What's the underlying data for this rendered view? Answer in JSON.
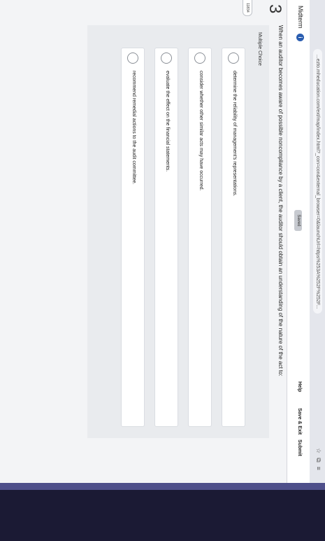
{
  "browser": {
    "url": "...ezto.mheducation.com/ext/map/index.html?_con=con&external_browser=0&launchUrl=https%253A%252F%252F..."
  },
  "header": {
    "title": "Midterm",
    "info_icon": "i",
    "saved_label": "Saved",
    "help_label": "Help",
    "save_exit_label": "Save & Exit",
    "submit_label": "Submit"
  },
  "question": {
    "number": "3",
    "side_tag": "11834",
    "text": "When an auditor becomes aware of possible noncompliance by a client, the auditor should obtain an understanding of the nature of the act to:",
    "type_label": "Multiple Choice",
    "choices": [
      {
        "label": "determine the reliability of management's representations."
      },
      {
        "label": "consider whether other similar acts may have occurred."
      },
      {
        "label": "evaluate the effect on the financial statements."
      },
      {
        "label": "recommend remedial actions to the audit committee."
      }
    ]
  }
}
